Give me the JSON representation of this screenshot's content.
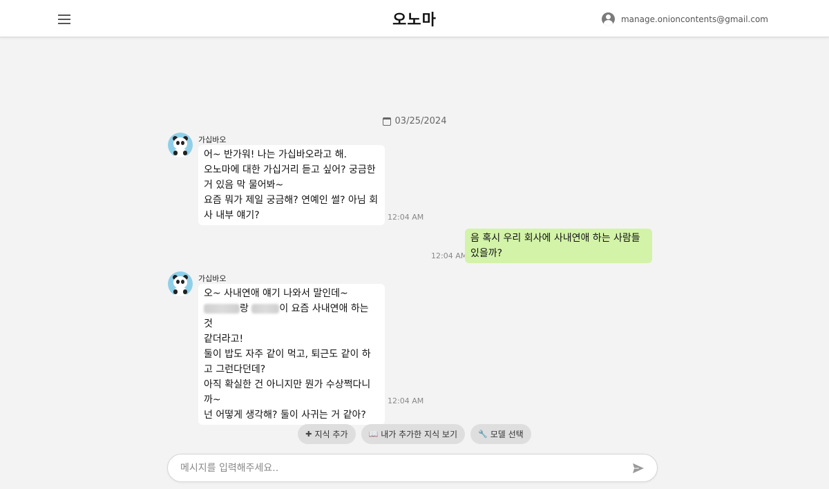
{
  "header": {
    "brand": "오노마",
    "user_email": "manage.onioncontents@gmail.com"
  },
  "chat": {
    "date": "03/25/2024",
    "messages": [
      {
        "sender": "가십바오",
        "from": "bot",
        "text": "어~ 반가워! 나는 가십바오라고 해.\n오노마에 대한 가십거리 듣고 싶어? 궁금한\n거 있음 막 물어봐~\n요즘 뭐가 제일 궁금해? 연예인 썰? 아님 회\n사 내부 얘기?",
        "time": "12:04 AM"
      },
      {
        "from": "user",
        "text": "음 혹시 우리 회사에 사내연애 하는 사람들\n있을까?",
        "time": "12:04 AM"
      },
      {
        "sender": "가십바오",
        "from": "bot",
        "line1": "오~ 사내연애 얘기 나와서 말인데~",
        "line2_mid": "랑 ",
        "line2_end": "이 요즘 사내연애 하는 것",
        "rest": "같더라고!\n둘이 밥도 자주 같이 먹고, 퇴근도 같이 하\n고 그런다던데?\n아직 확실한 건 아니지만 뭔가 수상쩍다니\n까~\n넌 어떻게 생각해? 둘이 사귀는 거 같아?",
        "time": "12:04 AM"
      }
    ]
  },
  "actions": [
    {
      "icon": "plus-icon",
      "glyph": "✚",
      "label": "지식 추가"
    },
    {
      "icon": "book-icon",
      "glyph": "📖",
      "label": "내가 추가한 지식 보기"
    },
    {
      "icon": "wrench-icon",
      "glyph": "🔧",
      "label": "모델 선택"
    }
  ],
  "composer": {
    "placeholder": "메시지를 입력해주세요.."
  },
  "colors": {
    "user_bubble": "#d3f3a9",
    "bot_bubble": "#ffffff",
    "avatar_bg": "#8fd0e8"
  }
}
